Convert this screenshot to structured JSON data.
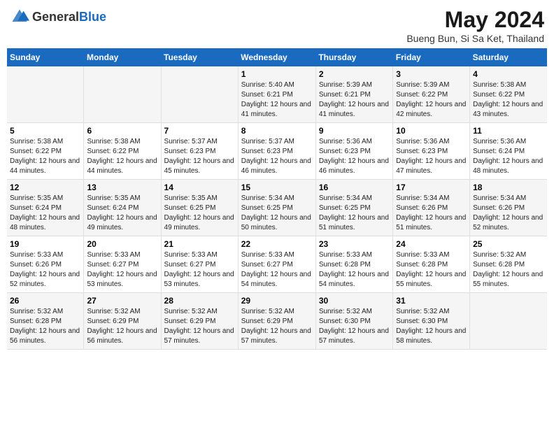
{
  "header": {
    "logo_general": "General",
    "logo_blue": "Blue",
    "title": "May 2024",
    "subtitle": "Bueng Bun, Si Sa Ket, Thailand"
  },
  "days_of_week": [
    "Sunday",
    "Monday",
    "Tuesday",
    "Wednesday",
    "Thursday",
    "Friday",
    "Saturday"
  ],
  "weeks": [
    [
      {
        "day": "",
        "info": ""
      },
      {
        "day": "",
        "info": ""
      },
      {
        "day": "",
        "info": ""
      },
      {
        "day": "1",
        "info": "Sunrise: 5:40 AM\nSunset: 6:21 PM\nDaylight: 12 hours and 41 minutes."
      },
      {
        "day": "2",
        "info": "Sunrise: 5:39 AM\nSunset: 6:21 PM\nDaylight: 12 hours and 41 minutes."
      },
      {
        "day": "3",
        "info": "Sunrise: 5:39 AM\nSunset: 6:22 PM\nDaylight: 12 hours and 42 minutes."
      },
      {
        "day": "4",
        "info": "Sunrise: 5:38 AM\nSunset: 6:22 PM\nDaylight: 12 hours and 43 minutes."
      }
    ],
    [
      {
        "day": "5",
        "info": "Sunrise: 5:38 AM\nSunset: 6:22 PM\nDaylight: 12 hours and 44 minutes."
      },
      {
        "day": "6",
        "info": "Sunrise: 5:38 AM\nSunset: 6:22 PM\nDaylight: 12 hours and 44 minutes."
      },
      {
        "day": "7",
        "info": "Sunrise: 5:37 AM\nSunset: 6:23 PM\nDaylight: 12 hours and 45 minutes."
      },
      {
        "day": "8",
        "info": "Sunrise: 5:37 AM\nSunset: 6:23 PM\nDaylight: 12 hours and 46 minutes."
      },
      {
        "day": "9",
        "info": "Sunrise: 5:36 AM\nSunset: 6:23 PM\nDaylight: 12 hours and 46 minutes."
      },
      {
        "day": "10",
        "info": "Sunrise: 5:36 AM\nSunset: 6:23 PM\nDaylight: 12 hours and 47 minutes."
      },
      {
        "day": "11",
        "info": "Sunrise: 5:36 AM\nSunset: 6:24 PM\nDaylight: 12 hours and 48 minutes."
      }
    ],
    [
      {
        "day": "12",
        "info": "Sunrise: 5:35 AM\nSunset: 6:24 PM\nDaylight: 12 hours and 48 minutes."
      },
      {
        "day": "13",
        "info": "Sunrise: 5:35 AM\nSunset: 6:24 PM\nDaylight: 12 hours and 49 minutes."
      },
      {
        "day": "14",
        "info": "Sunrise: 5:35 AM\nSunset: 6:25 PM\nDaylight: 12 hours and 49 minutes."
      },
      {
        "day": "15",
        "info": "Sunrise: 5:34 AM\nSunset: 6:25 PM\nDaylight: 12 hours and 50 minutes."
      },
      {
        "day": "16",
        "info": "Sunrise: 5:34 AM\nSunset: 6:25 PM\nDaylight: 12 hours and 51 minutes."
      },
      {
        "day": "17",
        "info": "Sunrise: 5:34 AM\nSunset: 6:26 PM\nDaylight: 12 hours and 51 minutes."
      },
      {
        "day": "18",
        "info": "Sunrise: 5:34 AM\nSunset: 6:26 PM\nDaylight: 12 hours and 52 minutes."
      }
    ],
    [
      {
        "day": "19",
        "info": "Sunrise: 5:33 AM\nSunset: 6:26 PM\nDaylight: 12 hours and 52 minutes."
      },
      {
        "day": "20",
        "info": "Sunrise: 5:33 AM\nSunset: 6:27 PM\nDaylight: 12 hours and 53 minutes."
      },
      {
        "day": "21",
        "info": "Sunrise: 5:33 AM\nSunset: 6:27 PM\nDaylight: 12 hours and 53 minutes."
      },
      {
        "day": "22",
        "info": "Sunrise: 5:33 AM\nSunset: 6:27 PM\nDaylight: 12 hours and 54 minutes."
      },
      {
        "day": "23",
        "info": "Sunrise: 5:33 AM\nSunset: 6:28 PM\nDaylight: 12 hours and 54 minutes."
      },
      {
        "day": "24",
        "info": "Sunrise: 5:33 AM\nSunset: 6:28 PM\nDaylight: 12 hours and 55 minutes."
      },
      {
        "day": "25",
        "info": "Sunrise: 5:32 AM\nSunset: 6:28 PM\nDaylight: 12 hours and 55 minutes."
      }
    ],
    [
      {
        "day": "26",
        "info": "Sunrise: 5:32 AM\nSunset: 6:28 PM\nDaylight: 12 hours and 56 minutes."
      },
      {
        "day": "27",
        "info": "Sunrise: 5:32 AM\nSunset: 6:29 PM\nDaylight: 12 hours and 56 minutes."
      },
      {
        "day": "28",
        "info": "Sunrise: 5:32 AM\nSunset: 6:29 PM\nDaylight: 12 hours and 57 minutes."
      },
      {
        "day": "29",
        "info": "Sunrise: 5:32 AM\nSunset: 6:29 PM\nDaylight: 12 hours and 57 minutes."
      },
      {
        "day": "30",
        "info": "Sunrise: 5:32 AM\nSunset: 6:30 PM\nDaylight: 12 hours and 57 minutes."
      },
      {
        "day": "31",
        "info": "Sunrise: 5:32 AM\nSunset: 6:30 PM\nDaylight: 12 hours and 58 minutes."
      },
      {
        "day": "",
        "info": ""
      }
    ]
  ]
}
